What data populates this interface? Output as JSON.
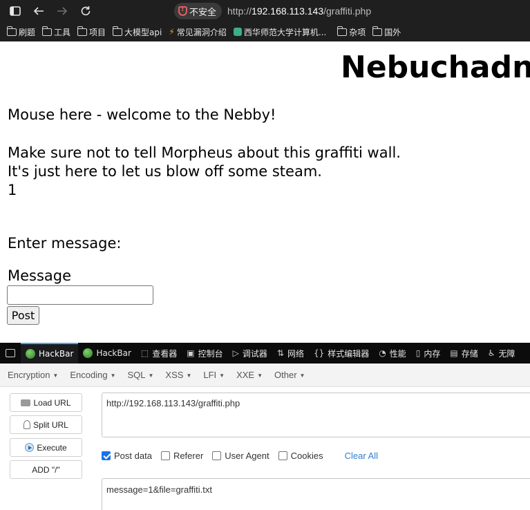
{
  "browser": {
    "security_label": "不安全",
    "url_scheme": "http://",
    "url_host": "192.168.113.143",
    "url_path": "/graffiti.php"
  },
  "bookmarks": [
    {
      "label": "刷题",
      "icon": "folder-icon"
    },
    {
      "label": "工具",
      "icon": "folder-icon"
    },
    {
      "label": "项目",
      "icon": "folder-icon"
    },
    {
      "label": "大模型api",
      "icon": "folder-icon"
    },
    {
      "label": "常见漏洞介绍",
      "icon": "bolt-icon"
    },
    {
      "label": "西华师范大学计算机...",
      "icon": "site-icon"
    },
    {
      "label": "杂项",
      "icon": "folder-icon"
    },
    {
      "label": "国外",
      "icon": "folder-icon"
    }
  ],
  "page": {
    "heading": "Nebuchadnezzar",
    "line1": "Mouse here - welcome to the Nebby!",
    "line2": "Make sure not to tell Morpheus about this graffiti wall.",
    "line3": "It's just here to let us blow off some steam.",
    "line4": "1",
    "enter_label": "Enter message:",
    "message_label": "Message",
    "message_value": "",
    "post_label": "Post"
  },
  "devtools": {
    "tabs": [
      {
        "label": "HackBar",
        "icon": "hackbar-icon",
        "active": true
      },
      {
        "label": "HackBar",
        "icon": "hackbar-icon",
        "active": false
      },
      {
        "label": "查看器",
        "icon": "inspector-icon",
        "active": false
      },
      {
        "label": "控制台",
        "icon": "console-icon",
        "active": false
      },
      {
        "label": "调试器",
        "icon": "debugger-icon",
        "active": false
      },
      {
        "label": "网络",
        "icon": "network-icon",
        "active": false
      },
      {
        "label": "样式编辑器",
        "icon": "braces-icon",
        "active": false
      },
      {
        "label": "性能",
        "icon": "performance-icon",
        "active": false
      },
      {
        "label": "内存",
        "icon": "memory-icon",
        "active": false
      },
      {
        "label": "存储",
        "icon": "storage-icon",
        "active": false
      },
      {
        "label": "无障",
        "icon": "accessibility-icon",
        "active": false
      }
    ]
  },
  "hackbar": {
    "menu": [
      "Encryption",
      "Encoding",
      "SQL",
      "XSS",
      "LFI",
      "XXE",
      "Other"
    ],
    "buttons": {
      "load_url": "Load URL",
      "split_url": "Split URL",
      "execute": "Execute",
      "add_slash": "ADD \"/\""
    },
    "url_value": "http://192.168.113.143/graffiti.php",
    "options": [
      {
        "label": "Post data",
        "checked": true
      },
      {
        "label": "Referer",
        "checked": false
      },
      {
        "label": "User Agent",
        "checked": false
      },
      {
        "label": "Cookies",
        "checked": false
      }
    ],
    "clear_all": "Clear All",
    "post_value": "message=1&file=graffiti.txt"
  },
  "colors": {
    "chrome_bg": "#1f1f1f",
    "devtools_bg": "#0c0c0d",
    "accent_blue": "#4aa2ff",
    "link_blue": "#2d7fd3",
    "checkbox_blue": "#1a73e8"
  }
}
